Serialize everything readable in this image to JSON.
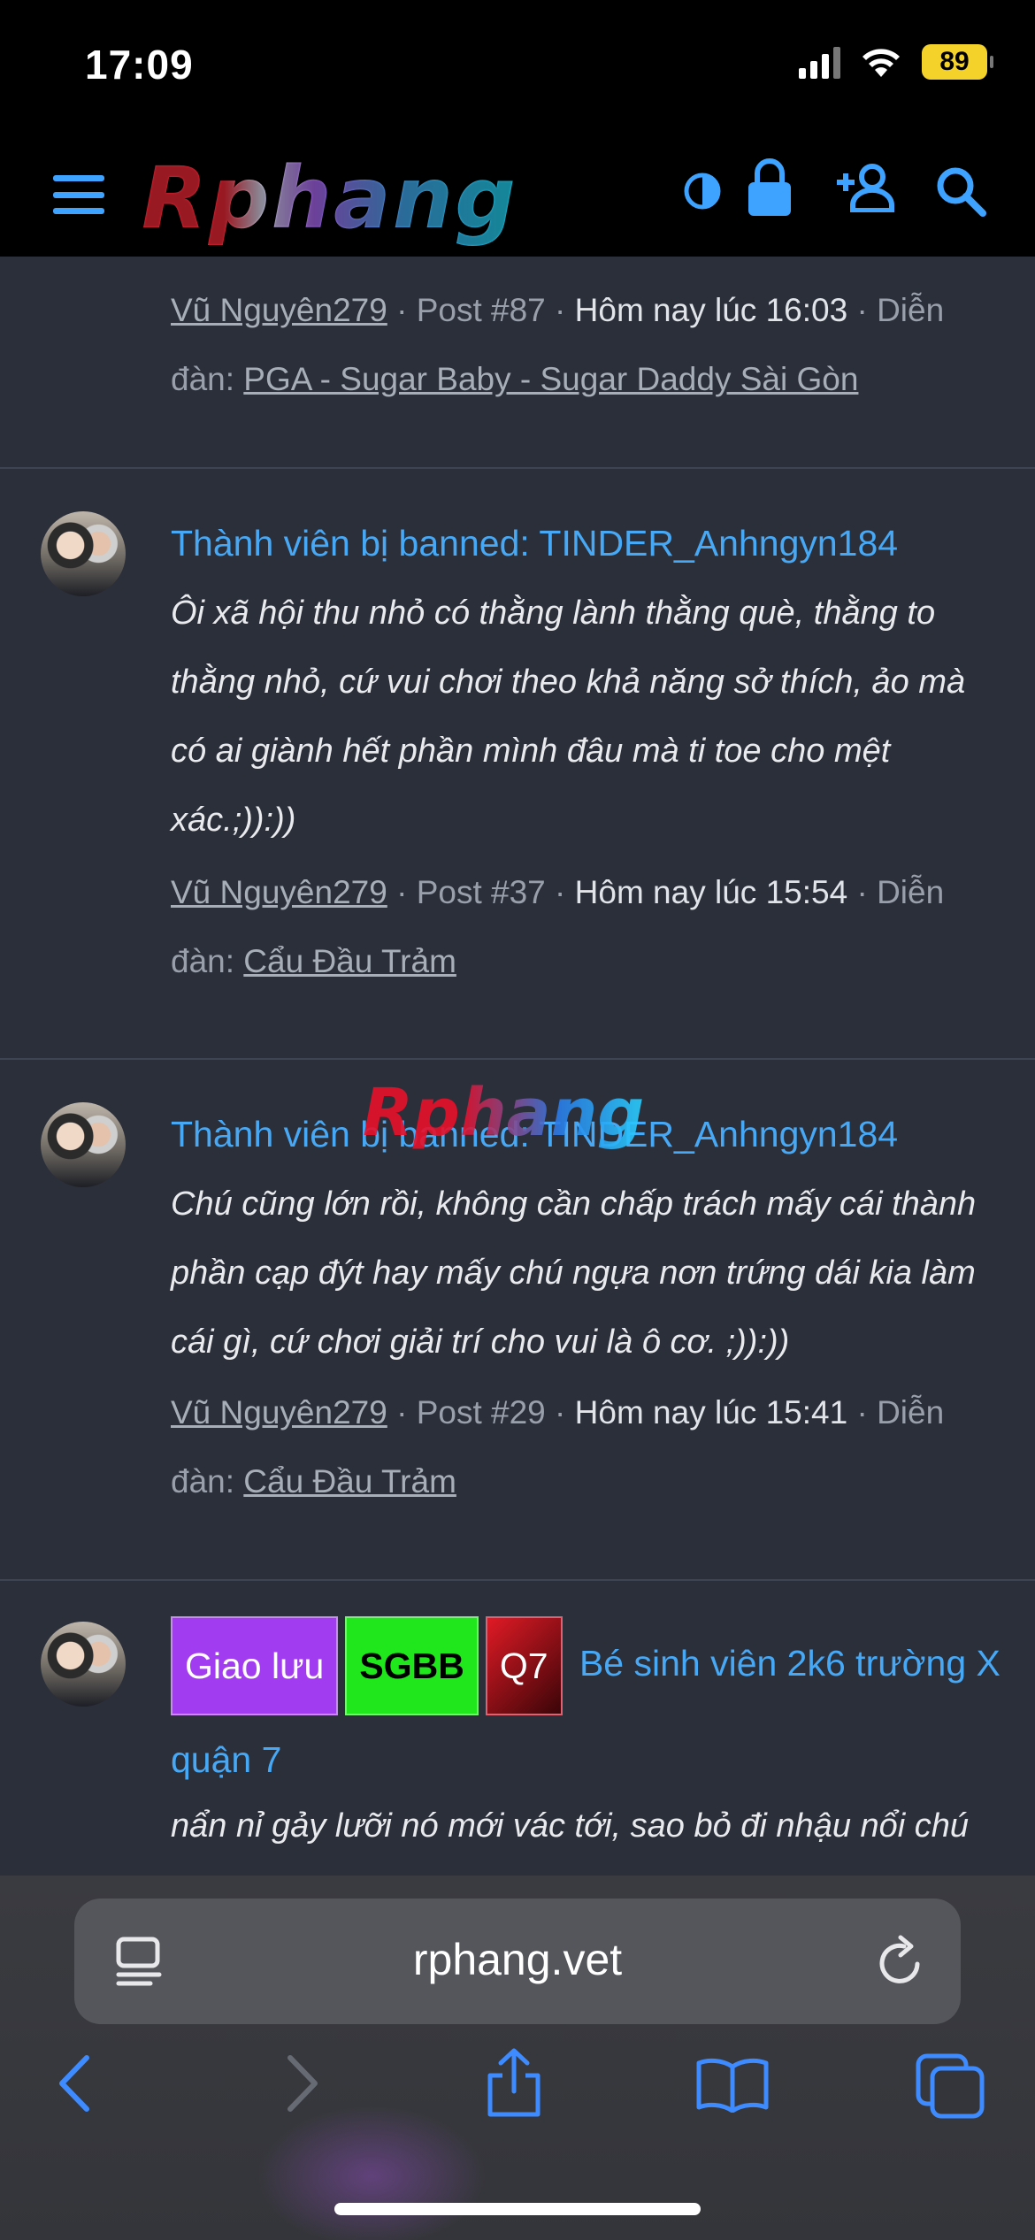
{
  "status_bar": {
    "time": "17:09",
    "battery": "89"
  },
  "header": {
    "logo": "Rphang"
  },
  "posts": [
    {
      "author": "Vũ Nguyên279",
      "post_no": "Post #87",
      "time": "Hôm nay lúc 16:03",
      "forum_label": "Diễn đàn:",
      "forum": "PGA - Sugar Baby - Sugar Daddy Sài Gòn"
    },
    {
      "title": "Thành viên bị banned: TINDER_Anhngyn184",
      "excerpt": "Ôi xã hội thu nhỏ có thằng lành thằng què, thằng to thằng nhỏ, cứ vui chơi theo khả năng sở thích, ảo mà có ai giành hết phần mình đâu mà ti toe cho mệt xác.;)):))",
      "author": "Vũ Nguyên279",
      "post_no": "Post #37",
      "time": "Hôm nay lúc 15:54",
      "forum_label": "Diễn đàn:",
      "forum": "Cẩu Đầu Trảm"
    },
    {
      "title": "Thành viên bị banned: TINDER_Anhngyn184",
      "excerpt": "Chú cũng lớn rồi, không cần chấp trách mấy cái thành phần cạp đýt hay mấy chú ngựa nơn trứng dái kia làm cái gì, cứ chơi giải trí cho vui là ô cơ. ;)):))",
      "author": "Vũ Nguyên279",
      "post_no": "Post #29",
      "time": "Hôm nay lúc 15:41",
      "forum_label": "Diễn đàn:",
      "forum": "Cẩu Đầu Trảm"
    },
    {
      "tags": [
        {
          "label": "Giao lưu",
          "bg": "#a23cf0",
          "fg": "#ffffff"
        },
        {
          "label": "SGBB",
          "bg": "#20e61c",
          "fg": "#000000"
        },
        {
          "label": "Q7",
          "bg": "#b0101a",
          "fg": "#ffffff"
        }
      ],
      "title": "Bé sinh viên 2k6 trường X quận 7",
      "excerpt": "nẩn nỉ gảy lưỡi nó mới vác tới, sao bỏ đi nhậu nổi chú"
    }
  ],
  "watermark": "Rphang",
  "browser": {
    "url": "rphang.vet"
  },
  "colors": {
    "link": "#47a8f5",
    "background": "#2b2f3a",
    "accent": "#3ea3ff"
  }
}
